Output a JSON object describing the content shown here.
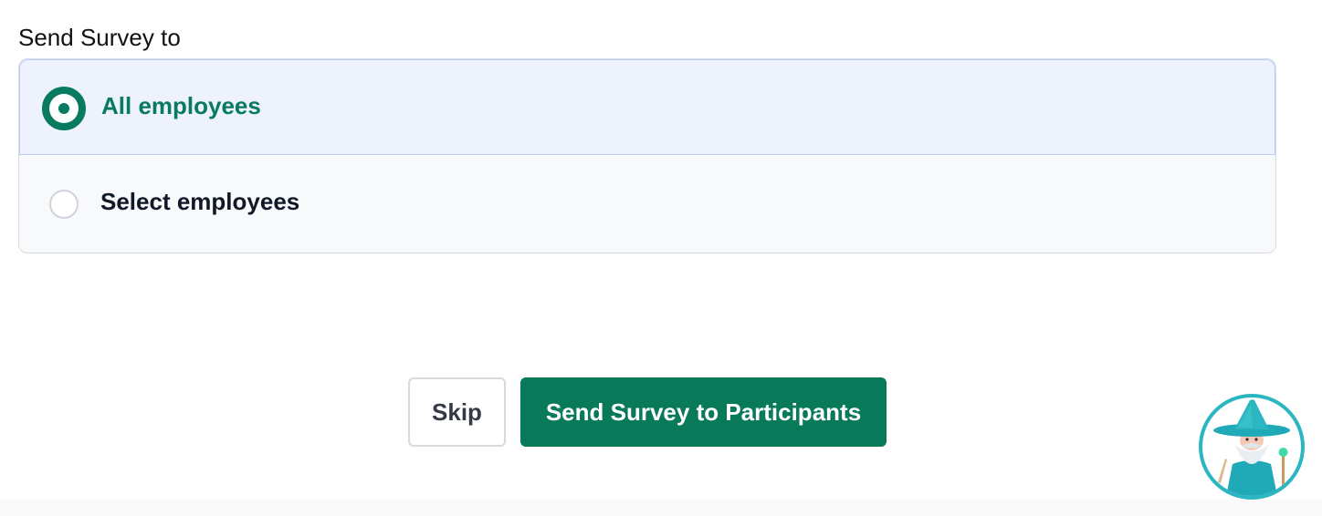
{
  "form": {
    "section_label": "Send Survey to",
    "options": [
      {
        "label": "All employees",
        "selected": true
      },
      {
        "label": "Select employees",
        "selected": false
      }
    ]
  },
  "actions": {
    "skip_label": "Skip",
    "send_label": "Send Survey to Participants"
  },
  "assistant": {
    "icon": "wizard-avatar-icon"
  },
  "colors": {
    "accent": "#087a5f",
    "selected_bg": "#edf2fd",
    "selected_border": "#b9cdf6",
    "primary_button": "#087a5a"
  }
}
